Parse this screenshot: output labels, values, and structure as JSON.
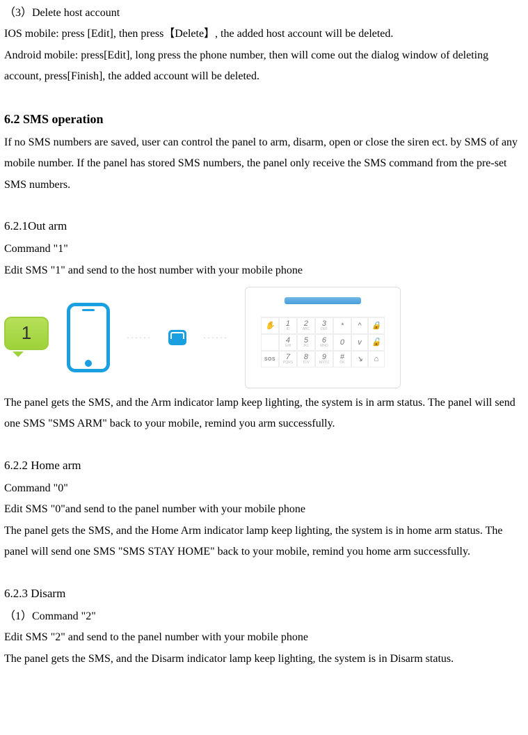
{
  "section_3": {
    "title": "（3）Delete host account",
    "p1": "IOS mobile: press [Edit], then press【Delete】, the added host account will be deleted.",
    "p2": "Android mobile: press[Edit], long press the phone number, then will come out the dialog window of deleting account, press[Finish], the added account will be deleted."
  },
  "sms_op": {
    "title": "6.2 SMS operation",
    "p1": "If no SMS numbers are saved, user can control the panel to arm, disarm, open or close the siren ect. by SMS of any mobile number. If the panel has stored SMS numbers, the panel only receive the SMS command from the pre-set SMS numbers."
  },
  "out_arm": {
    "title": "6.2.1Out arm",
    "cmd": "Command \"1\"",
    "edit": "Edit SMS \"1\" and send to the host number with your mobile phone",
    "bubble_digit": "1",
    "result": "The panel gets the SMS, and the Arm indicator lamp keep lighting, the system is in arm status. The panel will send one SMS \"SMS ARM\" back to your mobile, remind you arm successfully."
  },
  "home_arm": {
    "title": "6.2.2 Home arm",
    "cmd": "Command \"0\"",
    "edit": "Edit SMS \"0\"and send to the panel number with your mobile phone",
    "result": "The panel gets the SMS, and the Home Arm indicator lamp keep lighting, the system is in home arm status. The panel will send one SMS \"SMS STAY HOME\" back to your mobile, remind you home arm successfully."
  },
  "disarm": {
    "title": "6.2.3 Disarm",
    "cmd": "（1）Command \"2\"",
    "edit": "Edit SMS \"2\" and send to the panel number with your mobile phone",
    "result": "The panel gets the SMS, and the Disarm indicator lamp keep lighting, the system is in Disarm status."
  },
  "keypad": {
    "row1": [
      "1",
      "2",
      "3",
      "*"
    ],
    "row2": [
      "4",
      "5",
      "6",
      "0"
    ],
    "row3": [
      "7",
      "8",
      "9",
      "#"
    ],
    "sos": "SOS",
    "side": [
      "^",
      "🔒",
      "v",
      "🔓",
      "↘",
      "⌂"
    ]
  }
}
